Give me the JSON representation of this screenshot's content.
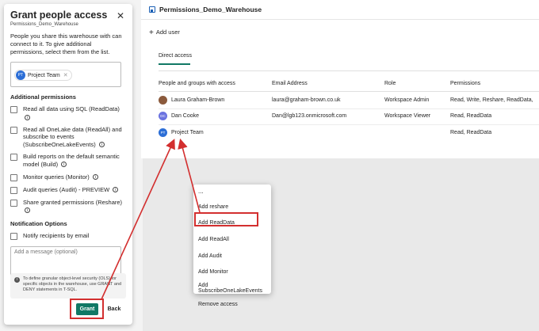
{
  "dialog": {
    "title": "Grant people access",
    "subtitle": "Permissions_Demo_Warehouse",
    "description": "People you share this warehouse with can connect to it. To give additional permissions, select them from the list.",
    "chip_label": "Project Team",
    "chip_initials": "PT",
    "additional_heading": "Additional permissions",
    "permissions": [
      "Read all data using SQL (ReadData)",
      "Read all OneLake data (ReadAll) and subscribe to events (SubscribeOneLakeEvents)",
      "Build reports on the default semantic model (Build)",
      "Monitor queries (Monitor)",
      "Audit queries (Audit) - PREVIEW",
      "Share granted permissions (Reshare)"
    ],
    "notification_heading": "Notification Options",
    "notify_label": "Notify recipients by email",
    "message_placeholder": "Add a message (optional)",
    "note": "To define granular object-level security (OLS) for specific objects in the warehouse, use GRANT and DENY statements in T-SQL.",
    "grant_label": "Grant",
    "back_label": "Back"
  },
  "page": {
    "title": "Permissions_Demo_Warehouse",
    "add_user_label": "Add user",
    "tab_label": "Direct access",
    "columns": [
      "People and groups with access",
      "Email Address",
      "Role",
      "Permissions"
    ],
    "rows": [
      {
        "name": "Laura Graham-Brown",
        "initials": "",
        "email": "laura@graham-brown.co.uk",
        "role": "Workspace Admin",
        "permissions": "Read, Write, Reshare, ReadData,"
      },
      {
        "name": "Dan Cooke",
        "initials": "DC",
        "email": "Dan@lgb123.onmicrosoft.com",
        "role": "Workspace Viewer",
        "permissions": "Read, ReadData"
      },
      {
        "name": "Project Team",
        "initials": "PT",
        "email": "",
        "role": "",
        "permissions": "Read, ReadData"
      }
    ]
  },
  "menu": {
    "dots": "...",
    "items": [
      "Add reshare",
      "Add ReadData",
      "Add ReadAll",
      "Add Audit",
      "Add Monitor",
      "Add SubscribeOneLakeEvents",
      "Remove access"
    ]
  },
  "colors": {
    "accent": "#117865",
    "highlight": "#d32f2f",
    "avatar_blue": "#2c6ed6"
  }
}
